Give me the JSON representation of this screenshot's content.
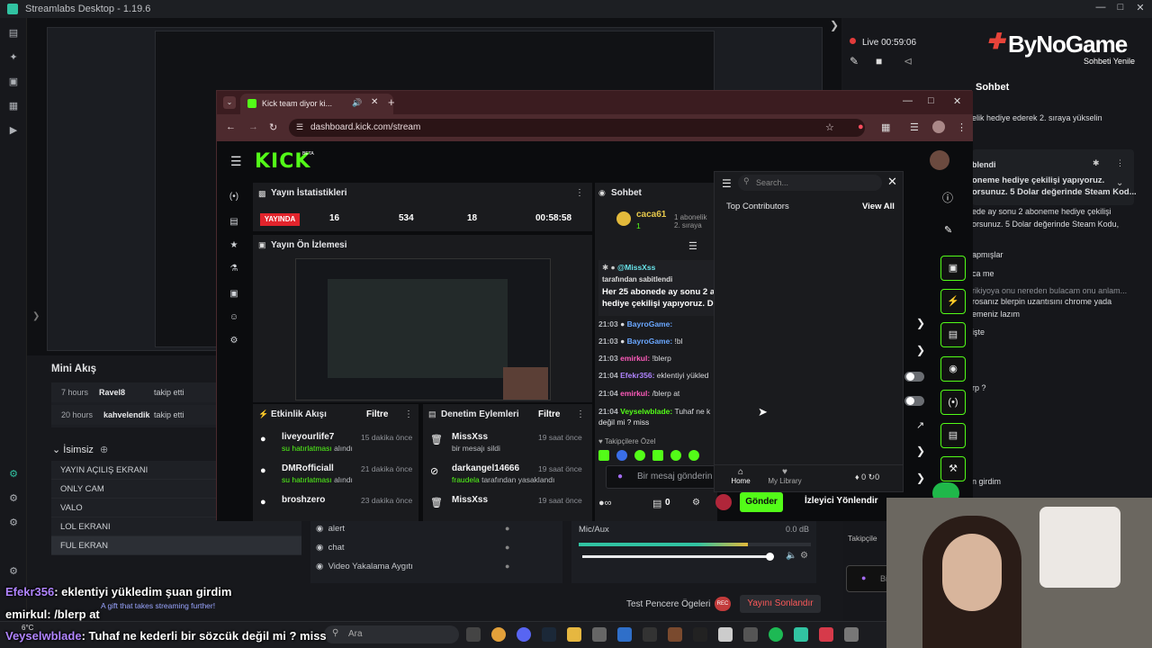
{
  "app": {
    "window_title": "Streamlabs Desktop - 1.19.6",
    "live_timer": "Live 00:59:06",
    "brand": "ByNoGame",
    "brand_sub": "Sohbeti Yenile"
  },
  "mini_feed": {
    "title": "Mini Akış",
    "items": [
      {
        "ago": "7 hours",
        "user": "Ravel8",
        "action": "takip etti"
      },
      {
        "ago": "20 hours",
        "user": "kahvelendik",
        "action": "takip etti"
      }
    ]
  },
  "scenes": {
    "title": "İsimsiz",
    "items": [
      "YAYIN AÇILIŞ EKRANI",
      "ONLY CAM",
      "VALO",
      "LOL EKRANI",
      "FUL EKRAN"
    ],
    "selected_index": 4
  },
  "sources": {
    "items": [
      "alert",
      "chat",
      "Video Yakalama Aygıtı"
    ]
  },
  "mixer": {
    "channel": "Mic/Aux",
    "level": "0.0 dB",
    "fill": 0.73
  },
  "footer": {
    "test_label": "Test Pencere Ögeleri",
    "end_stream": "Yayını Sonlandır"
  },
  "overlay_chat": [
    {
      "user": "Efekr356",
      "text": ": eklentiyi yükledim şuan girdim"
    },
    {
      "user": "emirkul",
      "text": ": /blerp at"
    },
    {
      "user": "Veyselwblade",
      "text": ": Tuhaf ne kederli bir sözcük değil mi ? miss"
    }
  ],
  "overlay_gift": "A gift that takes streaming further!",
  "browser": {
    "tab_title": "Kick team diyor ki...",
    "url": "dashboard.kick.com/stream"
  },
  "kick": {
    "logo": "KICK",
    "logo_badge": "BETA",
    "stats": {
      "title": "Yayın İstatistikleri",
      "status": "YAYINDA",
      "viewers": "16",
      "followers": "534",
      "subs": "18",
      "duration": "00:58:58"
    },
    "preview_title": "Yayın Ön İzlemesi",
    "activity": {
      "title": "Etkinlik Akışı",
      "filter": "Filtre",
      "items": [
        {
          "name": "liveyourlife7",
          "sub_hl": "su hatırlatması",
          "sub_rest": " alındı",
          "ago": "15 dakika önce"
        },
        {
          "name": "DMRofficiall",
          "sub_hl": "su hatırlatması",
          "sub_rest": " alındı",
          "ago": "21 dakika önce"
        },
        {
          "name": "broshzero",
          "sub_hl": "",
          "sub_rest": "",
          "ago": "23 dakika önce"
        }
      ]
    },
    "moderation": {
      "title": "Denetim Eylemleri",
      "filter": "Filtre",
      "items": [
        {
          "name": "MissXss",
          "sub_hl": "",
          "sub_rest": "bir mesajı sildi",
          "ago": "19 saat önce"
        },
        {
          "name": "darkangel14666",
          "sub_hl": "fraudela",
          "sub_rest": " tarafından yasaklandı",
          "ago": "19 saat önce"
        },
        {
          "name": "MissXss",
          "sub_hl": "",
          "sub_rest": "",
          "ago": "19 saat önce"
        }
      ]
    },
    "chat": {
      "title": "Sohbet",
      "top_user": "caca61",
      "top_count": "1",
      "top_rank": "1 abonelik",
      "top_rank2": "2. sıraya",
      "pinned_user": "@MissXss",
      "pinned_by": "tarafından sabitlendi",
      "pinned_text": "Her 25 abonede ay sonu 2 a",
      "pinned_text2": "hediye çekilişi yapıyoruz. D",
      "lines": [
        {
          "time": "21:03",
          "user": "BayroGame:",
          "text": ""
        },
        {
          "time": "21:03",
          "user": "BayroGame:",
          "text": " !bl"
        },
        {
          "time": "21:03",
          "user": "emirkul:",
          "text": " !blerp"
        },
        {
          "time": "21:04",
          "user": "Efekr356:",
          "text": " eklentiyi yükled"
        },
        {
          "time": "21:04",
          "user": "emirkul:",
          "text": " /blerp at"
        },
        {
          "time": "21:04",
          "user": "Veyselwblade:",
          "text": " Tuhaf ne k"
        }
      ],
      "last_line_cont": "değil mi ? miss",
      "emote_label": "Takipçilere Özel",
      "input_placeholder": "Bir mesaj gönderin",
      "send": "Gönder",
      "counter_a": "0",
      "viewer_redirect": "İzleyici Yönlendir"
    },
    "popup": {
      "search_placeholder": "Search...",
      "section": "Top Contributors",
      "view_all": "View All",
      "home": "Home",
      "library": "My Library",
      "count_a": "0",
      "count_b": "0"
    }
  },
  "right_chat": {
    "title": "Sohbet",
    "lines": [
      "elik hediye ederek 2. sıraya yükselin",
      "blendi",
      "oneme hediye çekilişi yapıyoruz.",
      "orsunuz. 5 Dolar değerinde Steam Kod...",
      "ede ay sonu 2 aboneme hediye çekilişi",
      "orsunuz. 5 Dolar değerinde Steam Kodu,",
      "apmışlar",
      "ca me",
      "rikiyoya onu nereden bulacam onu anlam...",
      "rosanız blerpin uzantısını chrome yada",
      "emeniz lazım",
      "işte",
      "rp ?",
      "n girdim"
    ],
    "follower_label": "Takipçile",
    "input_prefix": "Bi"
  },
  "taskbar": {
    "search": "Ara",
    "weather": "6°C"
  }
}
